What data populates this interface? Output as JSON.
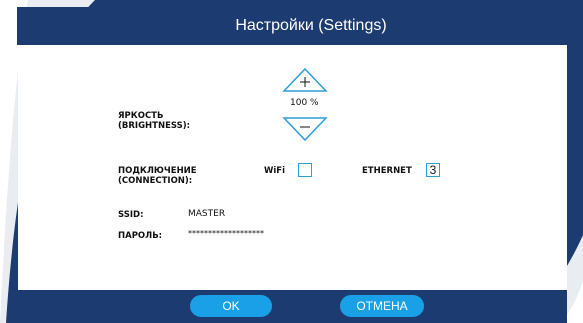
{
  "title": "Настройки (Settings)",
  "brightness": {
    "label_line1": "ЯРКОСТЬ",
    "label_line2": "(BRIGHTNESS):",
    "value": "100 %",
    "increase_symbol": "+",
    "decrease_symbol": "–"
  },
  "connection": {
    "label_line1": "ПОДКЛЮЧЕНИЕ",
    "label_line2": "(CONNECTION):",
    "wifi_label": "WiFi",
    "wifi_checked": false,
    "ethernet_label": "ETHERNET",
    "ethernet_value": "3"
  },
  "network": {
    "ssid_label": "SSID:",
    "ssid_value": "MASTER",
    "password_label": "ПАРОЛЬ:",
    "password_value": "*******************"
  },
  "buttons": {
    "ok_label": "OK",
    "cancel_label": "ОТМЕНА"
  },
  "colors": {
    "background": "#1c3b70",
    "accent": "#1aa0e6",
    "checkbox_border": "#2a9fd8",
    "panel": "#ffffff"
  }
}
